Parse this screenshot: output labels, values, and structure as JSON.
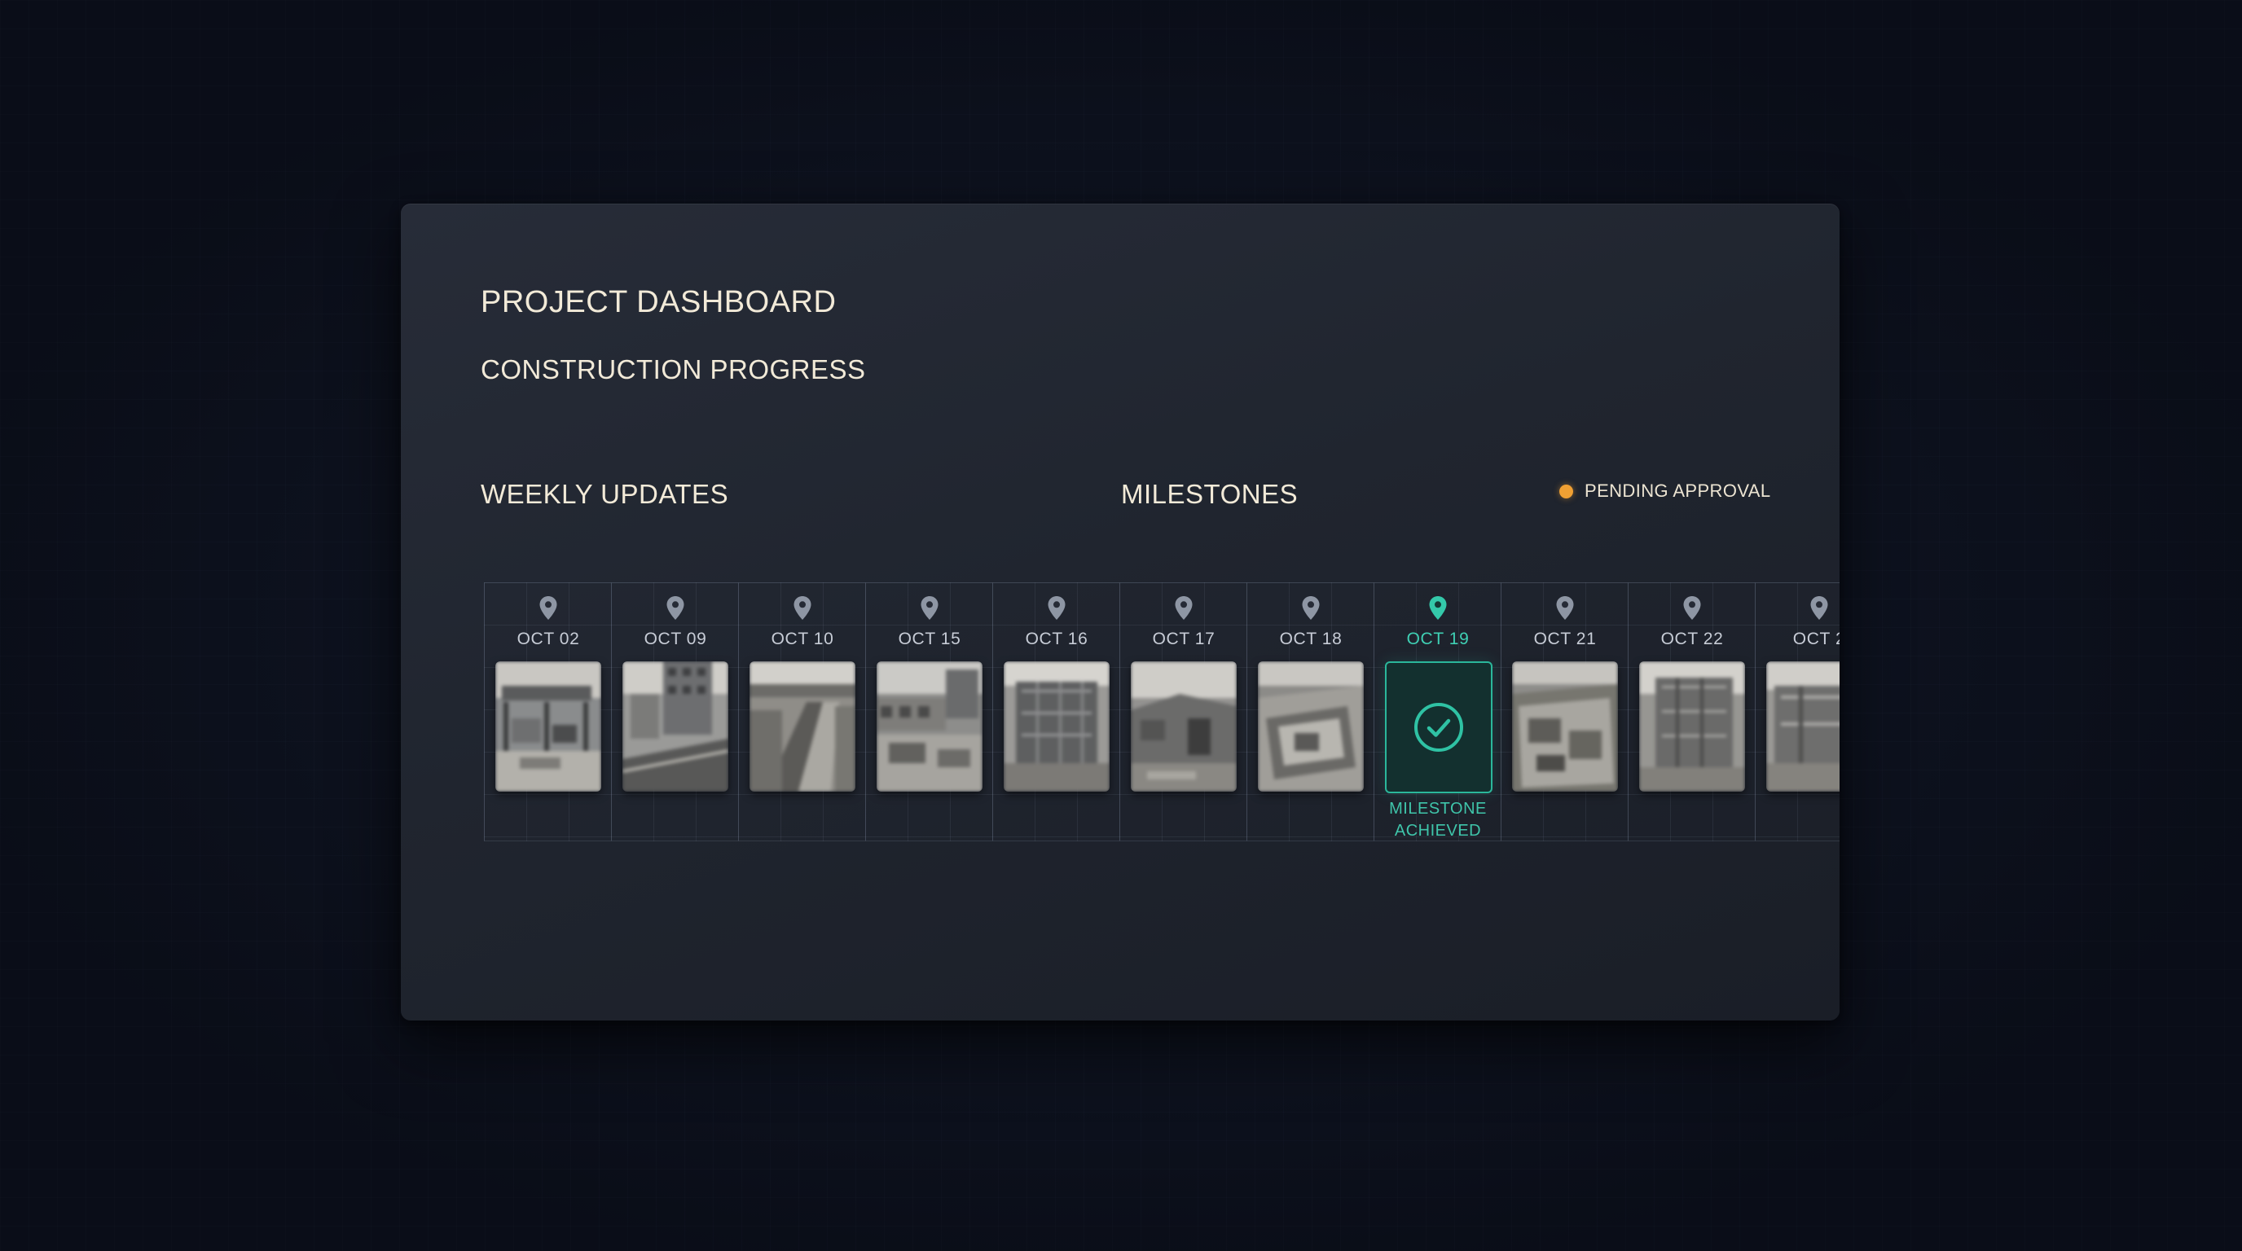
{
  "dashboard": {
    "title": "PROJECT DASHBOARD",
    "subtitle": "CONSTRUCTION PROGRESS"
  },
  "sections": {
    "weekly_updates": "WEEKLY UPDATES",
    "milestones": "MILESTONES"
  },
  "legend": {
    "pending_label": "PENDING APPROVAL",
    "pending_color": "#f0a033"
  },
  "colors": {
    "accent": "#2bb79b",
    "text_primary": "#f2ead8",
    "panel": "#20252f",
    "background": "#0d1220"
  },
  "timeline": {
    "entries": [
      {
        "date": "OCT 02",
        "icon": "map-pin-icon",
        "photo": "construction-photo"
      },
      {
        "date": "OCT 09",
        "icon": "map-pin-icon",
        "photo": "construction-photo"
      },
      {
        "date": "OCT 10",
        "icon": "map-pin-icon",
        "photo": "construction-photo"
      },
      {
        "date": "OCT 15",
        "icon": "map-pin-icon",
        "photo": "construction-photo"
      },
      {
        "date": "OCT 16",
        "icon": "map-pin-icon",
        "photo": "construction-photo"
      },
      {
        "date": "OCT 17",
        "icon": "map-pin-icon",
        "photo": "construction-photo"
      },
      {
        "date": "OCT 18",
        "icon": "map-pin-icon",
        "photo": "construction-photo"
      },
      {
        "date": "OCT 19",
        "icon": "map-pin-icon",
        "status_icon": "check-circle-icon",
        "milestone_label": "MILESTONE ACHIEVED"
      },
      {
        "date": "OCT 21",
        "icon": "map-pin-icon",
        "photo": "construction-photo"
      },
      {
        "date": "OCT 22",
        "icon": "map-pin-icon",
        "photo": "construction-photo"
      },
      {
        "date": "OCT 2",
        "icon": "map-pin-icon",
        "photo": "construction-photo"
      }
    ]
  }
}
